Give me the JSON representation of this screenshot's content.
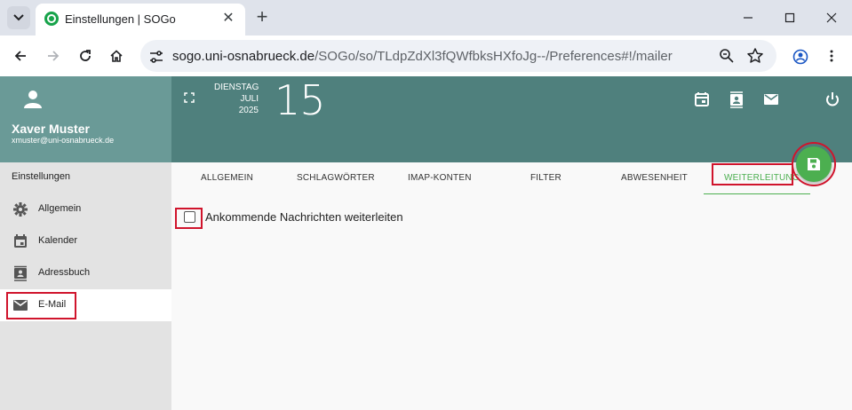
{
  "browser": {
    "tab_title": "Einstellungen | SOGo",
    "tab_close": "✕",
    "new_tab": "+",
    "url_host": "sogo.uni-osnabrueck.de",
    "url_path": "/SOGo/so/TLdpZdXl3fQWfbksHXfoJg--/Preferences#!/mailer"
  },
  "user": {
    "name": "Xaver Muster",
    "email": "xmuster@uni-osnabrueck.de"
  },
  "header": {
    "weekday": "DIENSTAG",
    "month": "JULI",
    "year": "2025",
    "day": "15"
  },
  "sidebar": {
    "heading": "Einstellungen",
    "items": [
      {
        "label": "Allgemein",
        "icon": "gear-icon"
      },
      {
        "label": "Kalender",
        "icon": "calendar-icon"
      },
      {
        "label": "Adressbuch",
        "icon": "contacts-icon"
      },
      {
        "label": "E-Mail",
        "icon": "mail-icon"
      }
    ]
  },
  "tabs": [
    {
      "label": "ALLGEMEIN"
    },
    {
      "label": "SCHLAGWÖRTER"
    },
    {
      "label": "IMAP-KONTEN"
    },
    {
      "label": "FILTER"
    },
    {
      "label": "ABWESENHEIT"
    },
    {
      "label": "WEITERLEITUNG"
    }
  ],
  "forwarding": {
    "checkbox_label": "Ankommende Nachrichten weiterleiten",
    "checked": false
  },
  "colors": {
    "header": "#4f807d",
    "user_panel": "#6a9a97",
    "accent": "#4caf50",
    "annotation": "#d0142c"
  }
}
